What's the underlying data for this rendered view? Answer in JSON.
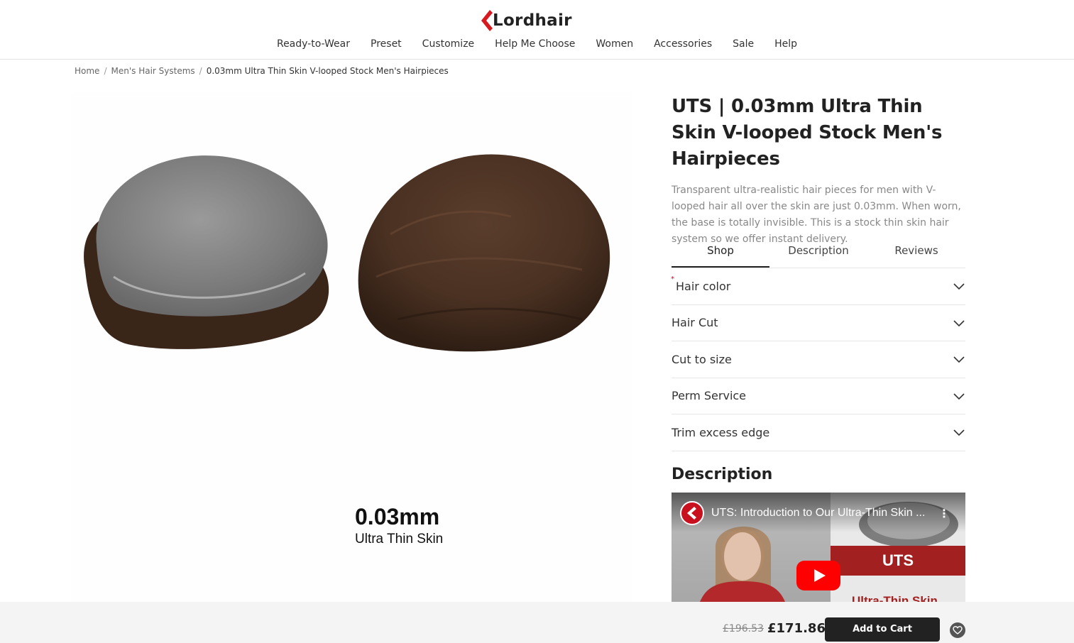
{
  "brand": {
    "name": "Lordhair"
  },
  "nav": {
    "items": [
      "Ready-to-Wear",
      "Preset",
      "Customize",
      "Help Me Choose",
      "Women",
      "Accessories",
      "Sale",
      "Help"
    ]
  },
  "breadcrumb": {
    "home": "Home",
    "category": "Men's Hair Systems",
    "current": "0.03mm Ultra Thin Skin V-looped Stock Men's Hairpieces",
    "separator": "/"
  },
  "gallery": {
    "caption_big": "0.03mm",
    "caption_small": "Ultra Thin Skin"
  },
  "product": {
    "title": "UTS | 0.03mm Ultra Thin Skin V-looped Stock Men's Hairpieces",
    "description": "Transparent ultra-realistic hair pieces for men with V-looped hair all over the skin are just 0.03mm. When worn, the base is totally invisible. This is a stock thin skin hair system so we offer instant delivery."
  },
  "tabs": [
    "Shop",
    "Description",
    "Reviews"
  ],
  "options": [
    {
      "label": "Hair color",
      "required_mark": "*"
    },
    {
      "label": "Hair Cut",
      "required_mark": ""
    },
    {
      "label": "Cut to size",
      "required_mark": ""
    },
    {
      "label": "Perm Service",
      "required_mark": ""
    },
    {
      "label": "Trim excess edge",
      "required_mark": ""
    }
  ],
  "description_section": {
    "heading": "Description",
    "video": {
      "title": "UTS: Introduction to Our Ultra-Thin Skin ...",
      "badge": "UTS",
      "subtitle": "Ultra-Thin Skin",
      "menu": "⋮"
    }
  },
  "cart_bar": {
    "old_price": "£196.53",
    "new_price": "£171.86",
    "add_to_cart": "Add to Cart"
  },
  "colors": {
    "accent_red": "#d71920",
    "button_dark": "#222222",
    "video_red": "#a32020"
  }
}
